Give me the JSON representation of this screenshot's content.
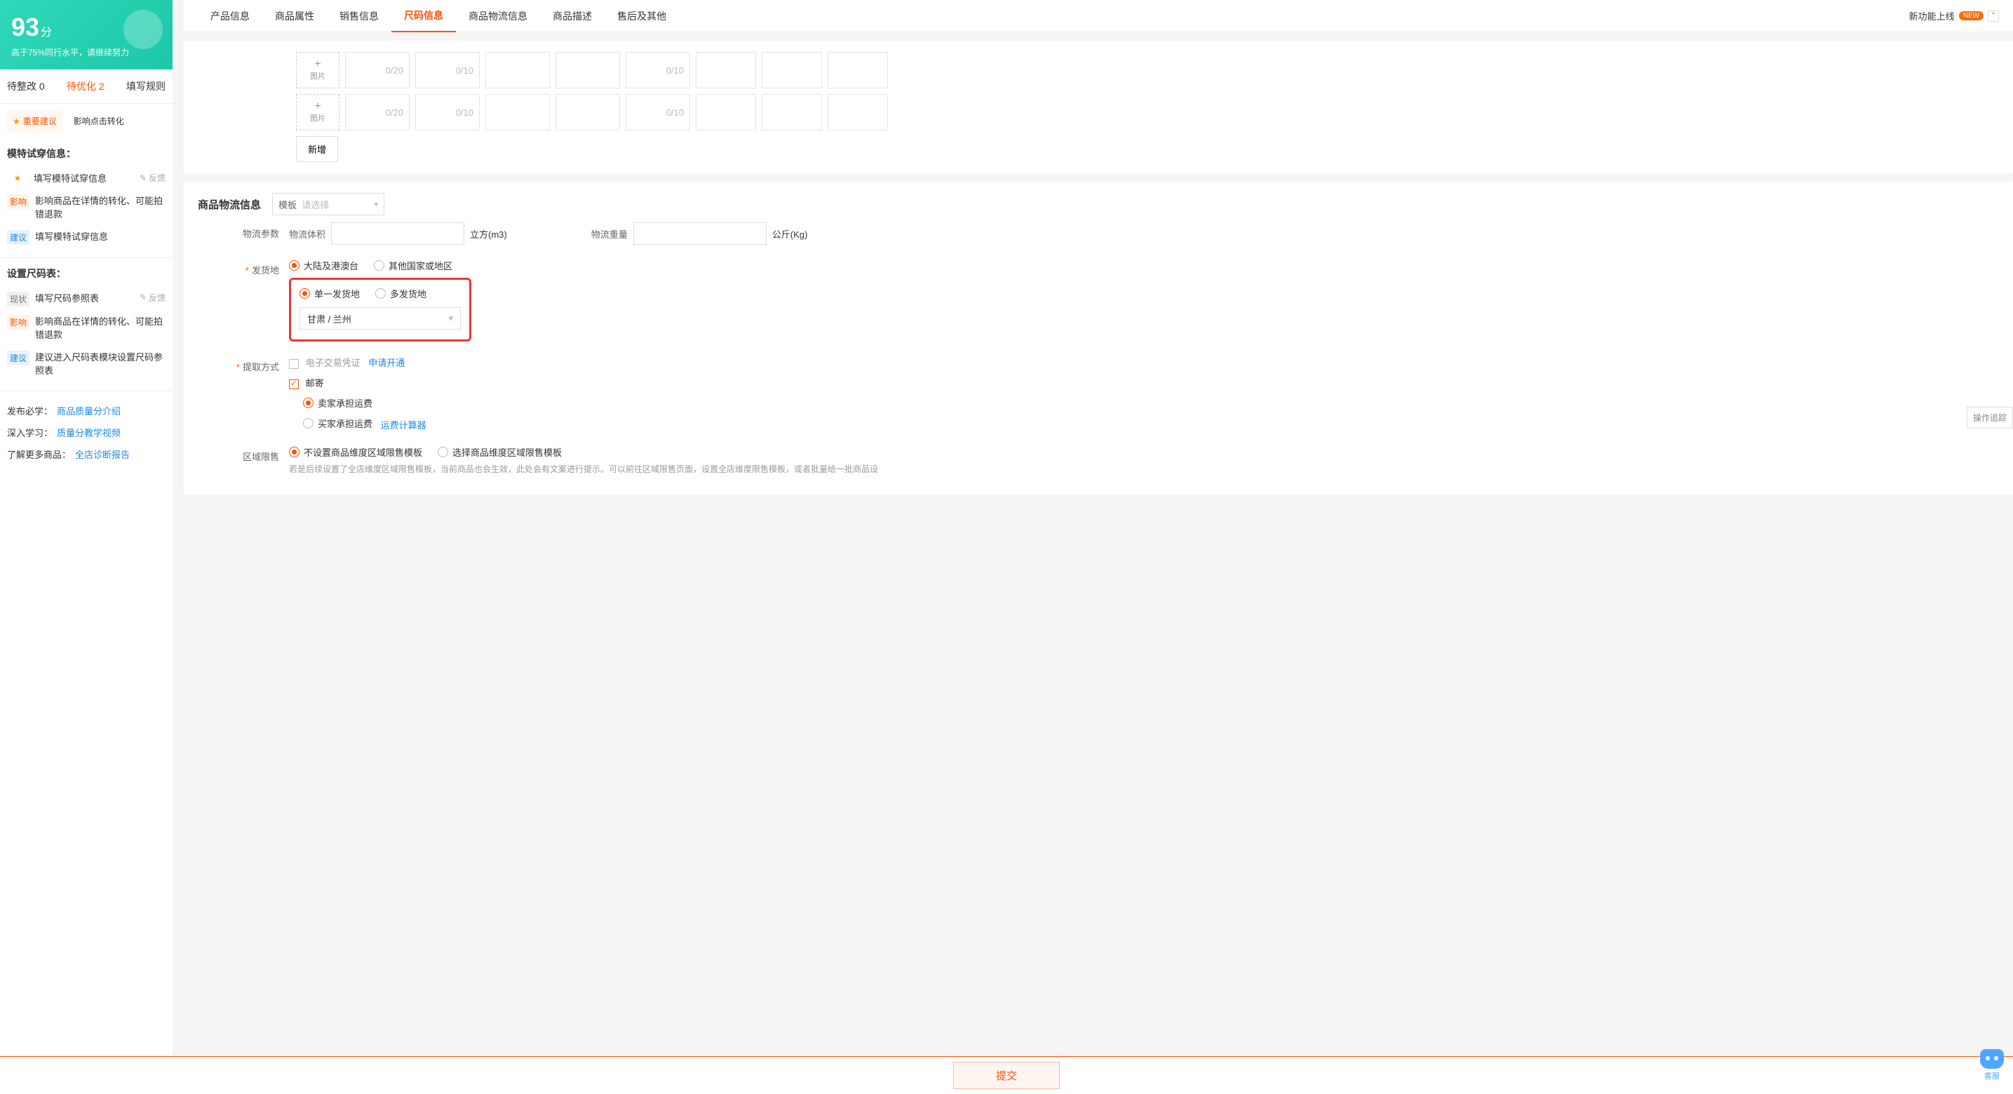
{
  "sidebar": {
    "score": "93",
    "score_unit": "分",
    "score_sub": "高于75%同行水平，请继续努力",
    "status": {
      "pending": "待整改 0",
      "optimize": "待优化 2",
      "rules": "填写规则"
    },
    "chips": {
      "important": "重要建议",
      "click": "影响点击转化"
    },
    "section_model_title": "模特试穿信息：",
    "model_r1": "填写模特试穿信息",
    "feedback": "反馈",
    "model_r2": "影响商品在详情的转化、可能拍错退款",
    "model_r3": "填写模特试穿信息",
    "section_size_title": "设置尺码表：",
    "size_r1": "填写尺码参照表",
    "size_r2": "影响商品在详情的转化、可能拍错退款",
    "size_r3": "建议进入尺码表模块设置尺码参照表",
    "tag_impact": "影响",
    "tag_suggest": "建议",
    "tag_status": "现状",
    "learn1_label": "发布必学：",
    "learn1_link": "商品质量分介绍",
    "learn2_label": "深入学习：",
    "learn2_link": "质量分教学视频",
    "learn3_label": "了解更多商品：",
    "learn3_link": "全店诊断报告"
  },
  "tabs": {
    "t1": "产品信息",
    "t2": "商品属性",
    "t3": "销售信息",
    "t4": "尺码信息",
    "t5": "商品物流信息",
    "t6": "商品描述",
    "t7": "售后及其他",
    "right_label": "新功能上线",
    "badge": "NEW"
  },
  "spec": {
    "img_label": "图片",
    "ph20": "0/20",
    "ph10": "0/10",
    "add_btn": "新增"
  },
  "logistics": {
    "title": "商品物流信息",
    "template_label": "模板",
    "template_ph": "请选择",
    "param_label": "物流参数",
    "volume_label": "物流体积",
    "volume_unit": "立方(m3)",
    "weight_label": "物流重量",
    "weight_unit": "公斤(Kg)",
    "ship_from_label": "发货地",
    "region1": "大陆及港澳台",
    "region2": "其他国家或地区",
    "mode_single": "单一发货地",
    "mode_multi": "多发货地",
    "ship_value": "甘肃 / 兰州",
    "pickup_label": "提取方式",
    "e_cert": "电子交易凭证",
    "apply_open": "申请开通",
    "mail": "邮寄",
    "seller_pay": "卖家承担运费",
    "buyer_pay": "买家承担运费",
    "calc": "运费计算器",
    "area_limit_label": "区域限售",
    "area_opt1": "不设置商品维度区域限售模板",
    "area_opt2": "选择商品维度区域限售模板",
    "area_help": "若是后续设置了全店维度区域限售模板，当前商品也会生效，此处会有文案进行提示。可以前往区域限售页面，设置全店维度限售模板，或者批量给一批商品设"
  },
  "footer": {
    "submit": "提交",
    "track": "操作追踪",
    "kf": "客服"
  }
}
